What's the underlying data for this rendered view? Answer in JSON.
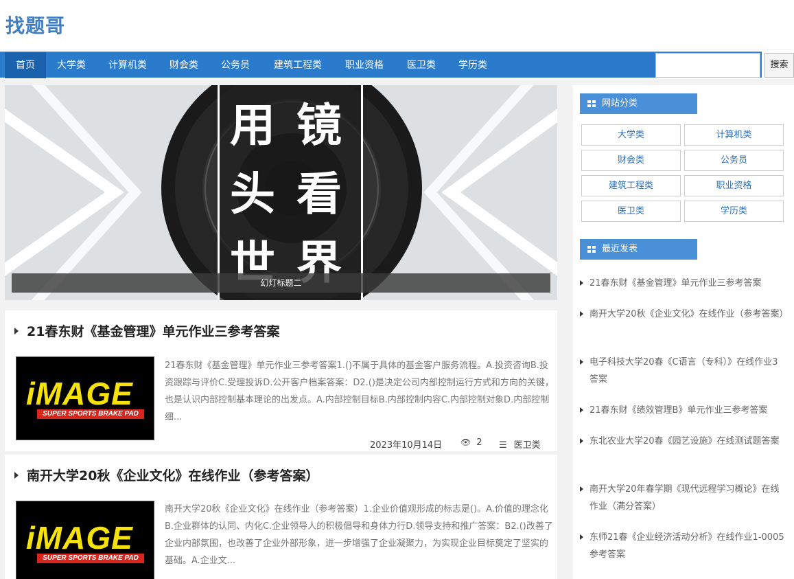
{
  "site": {
    "logo": "找题哥"
  },
  "nav": {
    "items": [
      {
        "label": "首页"
      },
      {
        "label": "大学类"
      },
      {
        "label": "计算机类"
      },
      {
        "label": "财会类"
      },
      {
        "label": "公务员"
      },
      {
        "label": "建筑工程类"
      },
      {
        "label": "职业资格"
      },
      {
        "label": "医卫类"
      },
      {
        "label": "学历类"
      }
    ],
    "search_value": "",
    "search_button": "搜索"
  },
  "slider": {
    "chars": [
      "用",
      "镜",
      "头",
      "看",
      "世",
      "界"
    ],
    "caption": "幻灯标题二"
  },
  "posts": [
    {
      "title": "21春东财《基金管理》单元作业三参考答案",
      "thumb_brand": "iMAGE",
      "thumb_tagline": "SUPER SPORTS BRAKE PAD",
      "excerpt": "21春东财《基金管理》单元作业三参考答案1.()不属于具体的基金客户服务流程。A.投资咨询B.投资跟踪与评价C.受理投诉D.公开客户档案答案：D2.()是决定公司内部控制运行方式和方向的关键，也是认识内部控制基本理论的出发点。A.内部控制目标B.内部控制内容C.内部控制对象D.内部控制细...",
      "date": "2023年10月14日",
      "views": "2",
      "category": "医卫类"
    },
    {
      "title": "南开大学20秋《企业文化》在线作业（参考答案）",
      "thumb_brand": "iMAGE",
      "thumb_tagline": "SUPER SPORTS BRAKE PAD",
      "excerpt": "南开大学20秋《企业文化》在线作业（参考答案）1.企业价值观形成的标志是()。A.价值的理念化B.企业群体的认同、内化C.企业领导人的积极倡导和身体力行D.领导支持和推广答案：B2.()改善了企业内部氛围，也改善了企业外部形象，进一步增强了企业凝聚力，为实现企业目标奠定了坚实的基础。A.企业文..."
    }
  ],
  "sidebar": {
    "categories_title": "网站分类",
    "categories": [
      "大学类",
      "计算机类",
      "财会类",
      "公务员",
      "建筑工程类",
      "职业资格",
      "医卫类",
      "学历类"
    ],
    "recent_title": "最近发表",
    "recent": [
      "21春东财《基金管理》单元作业三参考答案",
      "南开大学20秋《企业文化》在线作业（参考答案）",
      "电子科技大学20春《C语言（专科）》在线作业3答案",
      "21春东财《绩效管理B》单元作业三参考答案",
      "东北农业大学20春《园艺设施》在线测试题答案",
      "南开大学20年春学期《现代远程学习概论》在线作业（满分答案）",
      "东师21春《企业经济活动分析》在线作业1-0005参考答案"
    ]
  },
  "colors": {
    "nav_bg": "#2b7bcc",
    "nav_active": "#1a62ad",
    "logo": "#3f7ec0",
    "side_head": "#4a90d9",
    "category_text": "#2b6fb8"
  }
}
